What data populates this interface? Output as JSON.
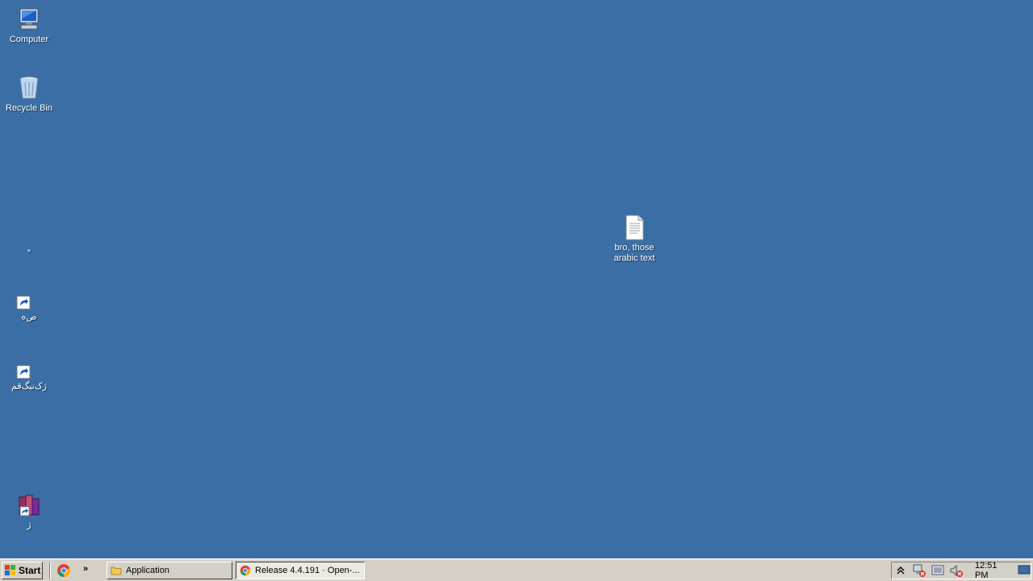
{
  "desktop": {
    "background_color": "#3a6ea5",
    "icons": {
      "computer": {
        "label": "Computer",
        "icon": "computer-icon"
      },
      "recycle_bin": {
        "label": "Recycle Bin",
        "icon": "recycle-bin-icon"
      },
      "arabic_dot": {
        "label": "ه",
        "icon": "blank-icon"
      },
      "shortcut_1": {
        "label": "ص‌ه",
        "icon": "shortcut-icon"
      },
      "shortcut_2": {
        "label": "ژک‌نیگ‌قم",
        "icon": "shortcut-icon"
      },
      "file": {
        "label_line1": "bro, those",
        "label_line2": "arabic text",
        "icon": "text-file-icon"
      },
      "books": {
        "label": "ژ",
        "icon": "books-shortcut-icon"
      }
    }
  },
  "taskbar": {
    "start_label": "Start",
    "tasks": [
      {
        "label": "Application",
        "icon": "folder-icon",
        "state": "up"
      },
      {
        "label": "Release 4.4.191 · Open-...",
        "icon": "chrome-icon",
        "state": "down"
      }
    ],
    "quick_launch": [
      "chrome-icon",
      "chevron-right-icon"
    ],
    "tray": {
      "icons": [
        "show-hidden-icon",
        "network-error-icon",
        "action-center-icon",
        "volume-muted-icon"
      ],
      "clock": "12:51 PM"
    }
  }
}
